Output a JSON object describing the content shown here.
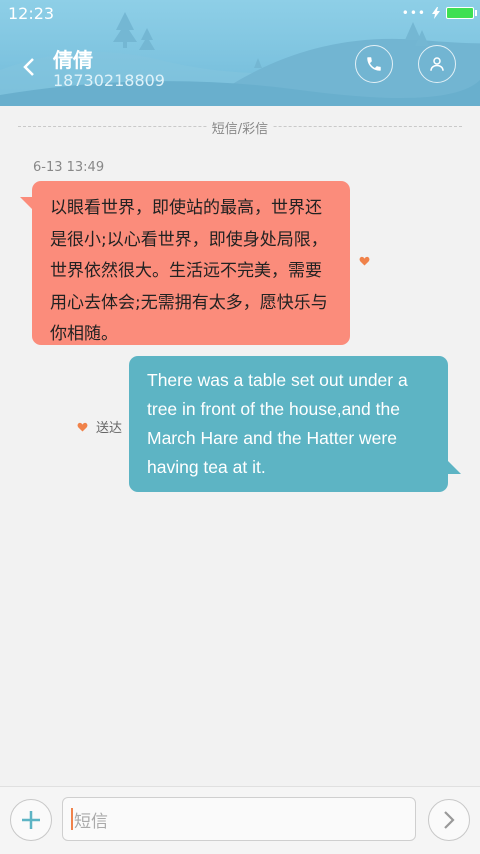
{
  "status_bar": {
    "time": "12:23"
  },
  "contact": {
    "name": "倩倩",
    "number": "18730218809"
  },
  "divider": {
    "label": "短信/彩信"
  },
  "messages": [
    {
      "direction": "incoming",
      "timestamp": "6-13 13:49",
      "lines": [
        "以眼看世界，即使站的最高，世界还",
        "是很小;以心看世界，即使身处局限，",
        "世界依然很大。生活远不完美，需要",
        "用心去体会;无需拥有太多，愿快乐与",
        "你相随。"
      ],
      "bubble_color": "#fb8c7b"
    },
    {
      "direction": "outgoing",
      "status": "送达",
      "lines": [
        "There was a table set out under a",
        "tree in front of the house,and the",
        "March Hare and the Hatter were",
        "having tea at it."
      ],
      "bubble_color": "#5db4c4"
    }
  ],
  "composer": {
    "placeholder": "短信"
  },
  "icons": {
    "back": "chevron-left-icon",
    "call": "phone-icon",
    "profile": "person-icon",
    "heart": "heart-icon",
    "add": "plus-icon",
    "send": "chevron-right-icon"
  },
  "colors": {
    "accent": "#f0824a",
    "header": "#7dc3df"
  }
}
